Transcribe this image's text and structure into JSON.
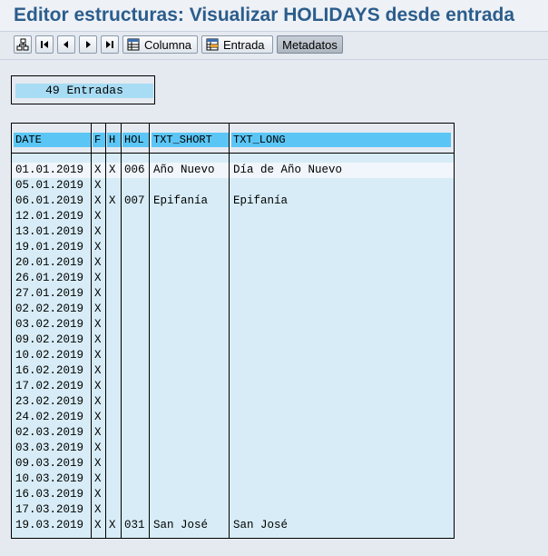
{
  "window": {
    "title": "Editor estructuras: Visualizar HOLIDAYS desde entrada"
  },
  "toolbar": {
    "buttons": [
      {
        "name": "details-icon",
        "label": ""
      },
      {
        "name": "first-page-icon",
        "label": ""
      },
      {
        "name": "previous-page-icon",
        "label": ""
      },
      {
        "name": "next-page-icon",
        "label": ""
      },
      {
        "name": "last-page-icon",
        "label": ""
      }
    ],
    "columna_label": "Columna",
    "entrada_label": "Entrada",
    "metadatos_label": "Metadatos"
  },
  "count": {
    "text": "49 Entradas"
  },
  "table": {
    "headers": [
      "DATE",
      "F",
      "H",
      "HOL",
      "TXT_SHORT",
      "TXT_LONG"
    ],
    "rows": [
      [
        "01.01.2019",
        "X",
        "X",
        "006",
        "Año Nuevo",
        "Día de Año Nuevo"
      ],
      [
        "05.01.2019",
        "X",
        "",
        "",
        "",
        ""
      ],
      [
        "06.01.2019",
        "X",
        "X",
        "007",
        "Epifanía",
        "Epifanía"
      ],
      [
        "12.01.2019",
        "X",
        "",
        "",
        "",
        ""
      ],
      [
        "13.01.2019",
        "X",
        "",
        "",
        "",
        ""
      ],
      [
        "19.01.2019",
        "X",
        "",
        "",
        "",
        ""
      ],
      [
        "20.01.2019",
        "X",
        "",
        "",
        "",
        ""
      ],
      [
        "26.01.2019",
        "X",
        "",
        "",
        "",
        ""
      ],
      [
        "27.01.2019",
        "X",
        "",
        "",
        "",
        ""
      ],
      [
        "02.02.2019",
        "X",
        "",
        "",
        "",
        ""
      ],
      [
        "03.02.2019",
        "X",
        "",
        "",
        "",
        ""
      ],
      [
        "09.02.2019",
        "X",
        "",
        "",
        "",
        ""
      ],
      [
        "10.02.2019",
        "X",
        "",
        "",
        "",
        ""
      ],
      [
        "16.02.2019",
        "X",
        "",
        "",
        "",
        ""
      ],
      [
        "17.02.2019",
        "X",
        "",
        "",
        "",
        ""
      ],
      [
        "23.02.2019",
        "X",
        "",
        "",
        "",
        ""
      ],
      [
        "24.02.2019",
        "X",
        "",
        "",
        "",
        ""
      ],
      [
        "02.03.2019",
        "X",
        "",
        "",
        "",
        ""
      ],
      [
        "03.03.2019",
        "X",
        "",
        "",
        "",
        ""
      ],
      [
        "09.03.2019",
        "X",
        "",
        "",
        "",
        ""
      ],
      [
        "10.03.2019",
        "X",
        "",
        "",
        "",
        ""
      ],
      [
        "16.03.2019",
        "X",
        "",
        "",
        "",
        ""
      ],
      [
        "17.03.2019",
        "X",
        "",
        "",
        "",
        ""
      ],
      [
        "19.03.2019",
        "X",
        "X",
        "031",
        "San José",
        "San José"
      ]
    ]
  },
  "colors": {
    "header": "#5bc6f5",
    "count_bg": "#a8dcf4",
    "grid_bg": "#d7ecf6",
    "title": "#2b5d8c"
  }
}
